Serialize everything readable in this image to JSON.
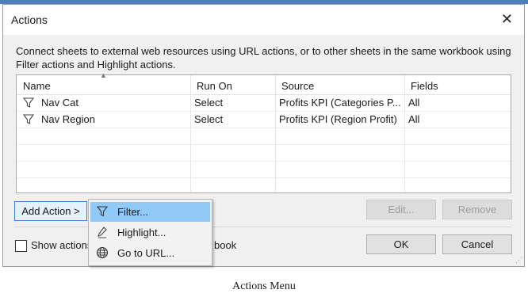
{
  "dialog": {
    "title": "Actions",
    "description": "Connect sheets to external web resources using URL actions, or to other sheets in the same workbook using Filter actions and Highlight actions."
  },
  "table": {
    "columns": [
      "Name",
      "Run On",
      "Source",
      "Fields"
    ],
    "rows": [
      {
        "name": "Nav Cat",
        "run_on": "Select",
        "source": "Profits KPI (Categories P...",
        "fields": "All",
        "icon": "filter-icon"
      },
      {
        "name": "Nav Region",
        "run_on": "Select",
        "source": "Profits KPI (Region Profit)",
        "fields": "All",
        "icon": "filter-icon"
      }
    ]
  },
  "buttons": {
    "add_action": "Add Action >",
    "edit": "Edit...",
    "remove": "Remove",
    "ok": "OK",
    "cancel": "Cancel"
  },
  "checkbox": {
    "label_left": "Show actions",
    "label_right": "book"
  },
  "menu": {
    "items": [
      {
        "label": "Filter...",
        "icon": "filter-icon",
        "selected": true
      },
      {
        "label": "Highlight...",
        "icon": "highlight-pen-icon",
        "selected": false
      },
      {
        "label": "Go to URL...",
        "icon": "globe-icon",
        "selected": false
      }
    ]
  },
  "caption": "Actions Menu"
}
